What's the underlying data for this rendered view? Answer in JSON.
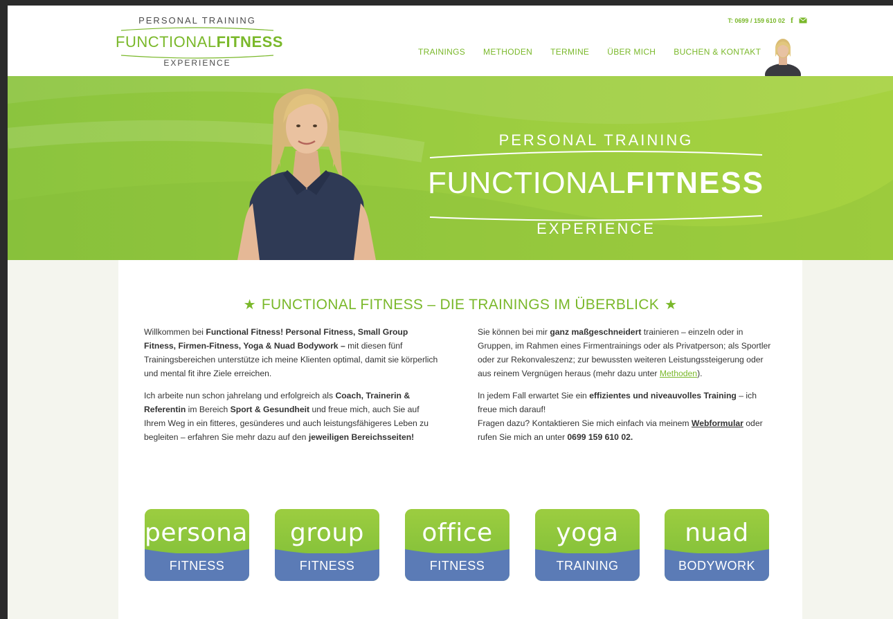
{
  "header": {
    "logo": {
      "top": "PERSONAL TRAINING",
      "main_light": "FUNCTIONAL",
      "main_bold": "FITNESS",
      "bottom": "EXPERIENCE"
    },
    "phone": "T: 0699 / 159 610 02",
    "social_icons": [
      "facebook-icon",
      "mail-icon"
    ],
    "nav": [
      "TRAININGS",
      "METHODEN",
      "TERMINE",
      "ÜBER MICH",
      "BUCHEN & KONTAKT"
    ]
  },
  "hero": {
    "top": "PERSONAL TRAINING",
    "main_light": "FUNCTIONAL",
    "main_bold": "FITNESS",
    "bottom": "EXPERIENCE"
  },
  "main": {
    "title": "FUNCTIONAL FITNESS – DIE TRAININGS IM ÜBERBLICK",
    "left": {
      "p1_a": "Willkommen bei ",
      "p1_b": "Functional Fitness! Personal Fitness, Small Group Fitness, Firmen-Fitness, Yoga & Nuad Bodywork –",
      "p1_c": " mit diesen fünf Trainingsbereichen unterstütze ich meine Klienten optimal, damit sie körperlich und mental fit ihre Ziele erreichen.",
      "p2_a": "Ich arbeite nun schon jahrelang und erfolgreich als ",
      "p2_b": "Coach, Trainerin & Referentin",
      "p2_c": " im Bereich ",
      "p2_d": "Sport & Gesundheit",
      "p2_e": " und freue mich, auch Sie auf Ihrem Weg in ein fitteres, gesünderes und auch leistungsfähigeres Leben zu begleiten – erfahren Sie mehr dazu auf den ",
      "p2_f": "jeweiligen Bereichsseiten!"
    },
    "right": {
      "p1_a": "Sie können bei mir ",
      "p1_b": "ganz maßgeschneidert",
      "p1_c": " trainieren – einzeln oder in Gruppen, im Rahmen eines Firmentrainings oder als Privatperson; als Sportler oder zur Rekonvaleszenz; zur bewussten weiteren Leistungssteigerung oder aus reinem Vergnügen heraus (mehr dazu unter ",
      "p1_link": "Methoden",
      "p1_d": ").",
      "p2_a": "In jedem Fall erwartet Sie ein ",
      "p2_b": "effizientes und niveauvolles Training",
      "p2_c": " – ich freue mich darauf!",
      "p3_a": "Fragen dazu? Kontaktieren Sie mich einfach via meinem ",
      "p3_link": "Webformular",
      "p3_b": " oder rufen Sie mich an unter ",
      "p3_phone": "0699 159 610 02."
    },
    "tiles": [
      {
        "script": "personal",
        "sub": "FITNESS"
      },
      {
        "script": "group",
        "sub": "FITNESS"
      },
      {
        "script": "office",
        "sub": "FITNESS"
      },
      {
        "script": "yoga",
        "sub": "TRAINING"
      },
      {
        "script": "nuad",
        "sub": "BODYWORK"
      }
    ]
  },
  "colors": {
    "accent_green": "#7ab82a",
    "hero_green": "#9ccd40",
    "tile_blue": "#5b7bb6"
  }
}
